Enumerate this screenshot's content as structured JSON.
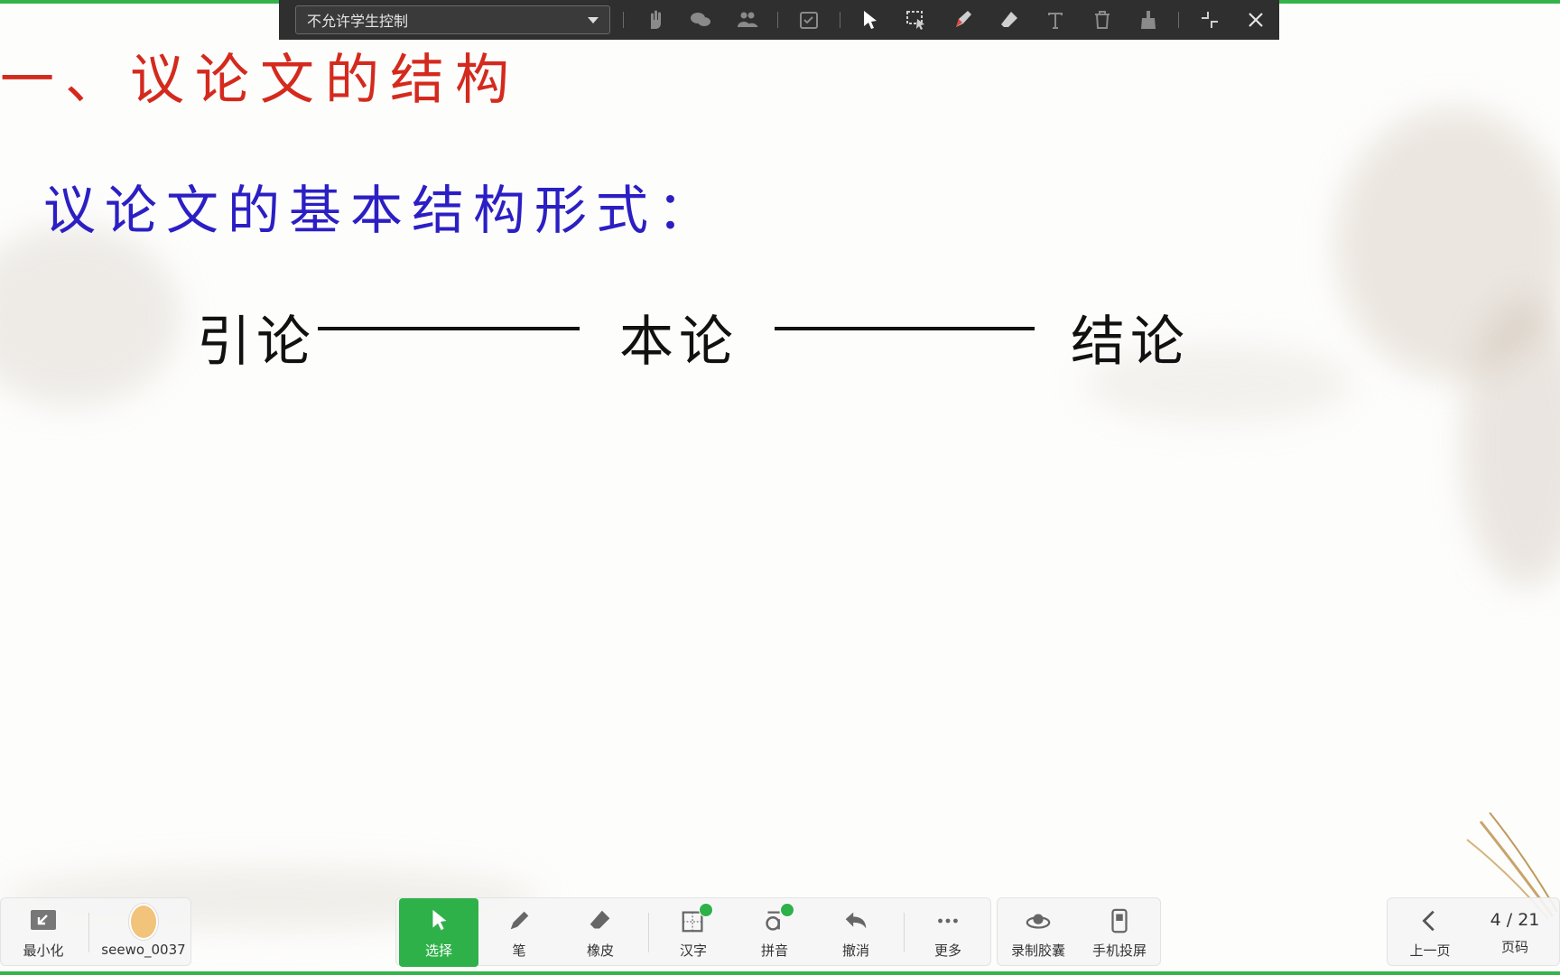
{
  "toolbar_top": {
    "control_select": "不允许学生控制",
    "icons": [
      "hand-raise-icon",
      "discussion-icon",
      "group-icon",
      "check-task-icon",
      "pointer-icon",
      "marquee-select-icon",
      "pen-icon",
      "eraser-icon",
      "text-icon",
      "trash-icon",
      "brush-clear-icon",
      "collapse-icon",
      "close-icon"
    ]
  },
  "slide": {
    "title": "一、议论文的结构",
    "subtitle": "议论文的基本结构形式：",
    "structure": {
      "part1": "引论",
      "part2": "本论",
      "part3": "结论"
    }
  },
  "toolbar_bottom": {
    "minimize": "最小化",
    "user": "seewo_0037",
    "select": "选择",
    "pen": "笔",
    "eraser": "橡皮",
    "hanzi": "汉字",
    "pinyin": "拼音",
    "undo": "撤消",
    "more": "更多",
    "capsule": "录制胶囊",
    "phone_cast": "手机投屏",
    "prev_page": "上一页",
    "page_label": "页码",
    "page_current": "4",
    "page_total": "21",
    "page_display": "4 / 21"
  },
  "colors": {
    "accent_green": "#2fb14a",
    "title_red": "#d42a1e",
    "subtitle_blue": "#2b1fc4"
  }
}
